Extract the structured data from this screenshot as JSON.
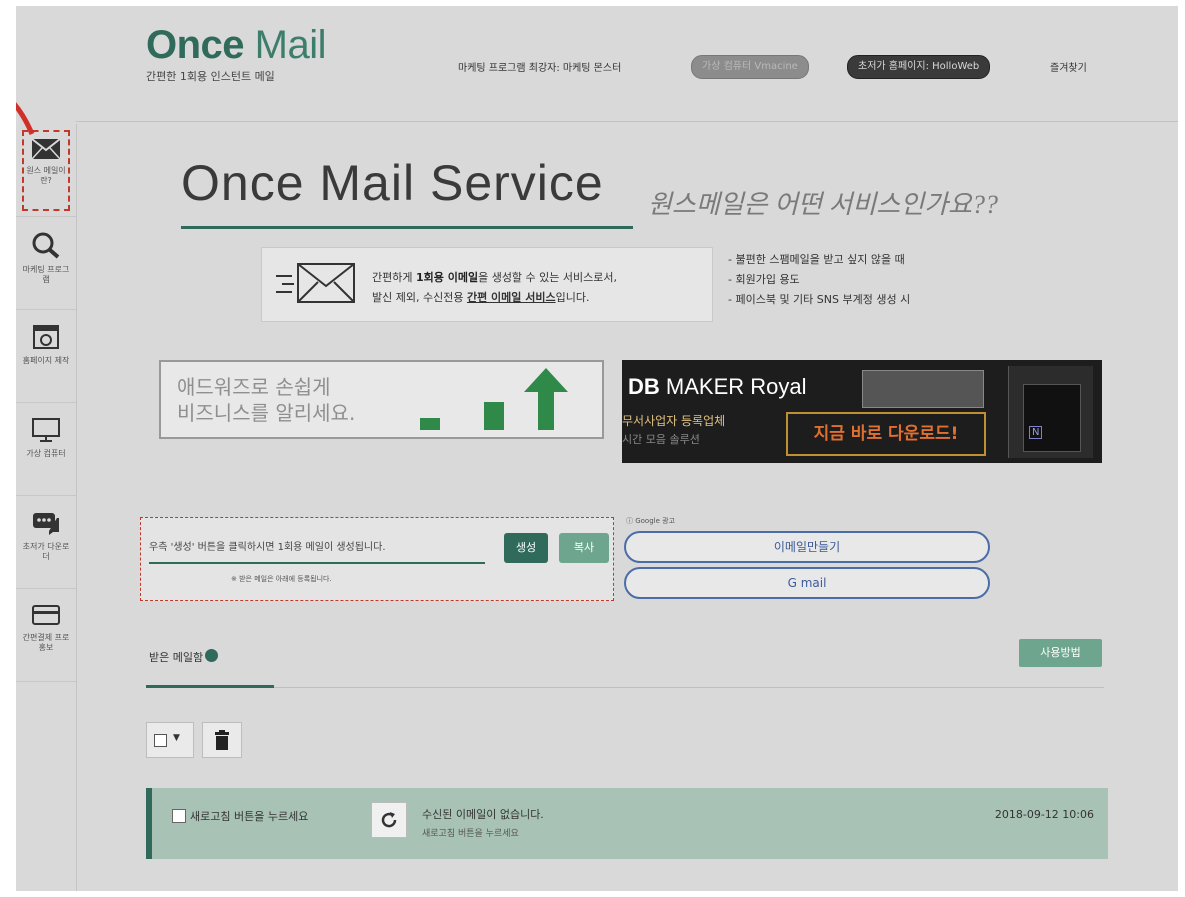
{
  "header": {
    "logo_once": "Once",
    "logo_mail": "Mail",
    "logo_sub": "간편한 1회용 인스턴트 메일",
    "link_marketing": "마케팅 프로그램 최강자: 마케팅 몬스터",
    "pill_hosting": "가상 컴퓨터 Vmacine",
    "pill_homepage": "초저가 홈페이지: HolloWeb",
    "bookmark": "즐겨찾기"
  },
  "sidebar": {
    "items": [
      {
        "label": "원스 메일이란?",
        "icon": "envelope-icon"
      },
      {
        "label": "마케팅 프로그램",
        "icon": "search-icon"
      },
      {
        "label": "홈페이지 제작",
        "icon": "homepage-icon"
      },
      {
        "label": "가상 컴퓨터",
        "icon": "monitor-icon"
      },
      {
        "label": "초저가 다운로더",
        "icon": "chat-icon"
      },
      {
        "label": "간편결제 프로 홍보",
        "icon": "card-icon"
      }
    ]
  },
  "hero": {
    "title": "Once Mail Service",
    "subtitle": "원스메일은 어떤 서비스인가요??"
  },
  "intro": {
    "line1_pre": "간편하게 ",
    "line1_bold": "1회용 이메일",
    "line1_post": "을 생성할 수 있는 서비스로서,",
    "line2_pre": "발신 제외, 수신전용 ",
    "line2_u": "간편 이메일 서비스",
    "line2_post": "입니다.",
    "bullets": [
      "- 불편한 스팸메일을 받고 싶지 않을 때",
      "- 회원가입 용도",
      "- 페이스북 및 기타 SNS 부계정 생성 시"
    ]
  },
  "ads": {
    "left_line1": "애드워즈로 손쉽게",
    "left_line2": "비즈니스를 알리세요.",
    "right_brand": "DB",
    "right_brand2": " MAKER Royal",
    "right_line2": "무서사업자 등록업체",
    "right_line3": "시간 모음 솔루션",
    "right_cta": "지금 바로 다운로드!",
    "google_label": "ⓘ Google 광고",
    "make_email": "이메일만들기",
    "gmail": "G mail"
  },
  "generate": {
    "hint": "우측 '생성' 버튼을 클릭하시면 1회용 메일이 생성됩니다.",
    "note": "※ 받은 메일은 아래에 등록됩니다.",
    "generate_btn": "생성",
    "copy_btn": "복사"
  },
  "inbox": {
    "tab_label": "받은 메일함",
    "howto_btn": "사용방법",
    "row": {
      "checkbox_label": "새로고침 버튼을 누르세요",
      "subject": "수신된 이메일이 없습니다.",
      "sub": "새로고침 버튼을 누르세요",
      "date": "2018-09-12 10:06"
    }
  },
  "colors": {
    "brand": "#2f6a5a",
    "accent_light": "#6ea58e",
    "row_bg": "#a8c3b6",
    "highlight_border": "#c0392b"
  }
}
